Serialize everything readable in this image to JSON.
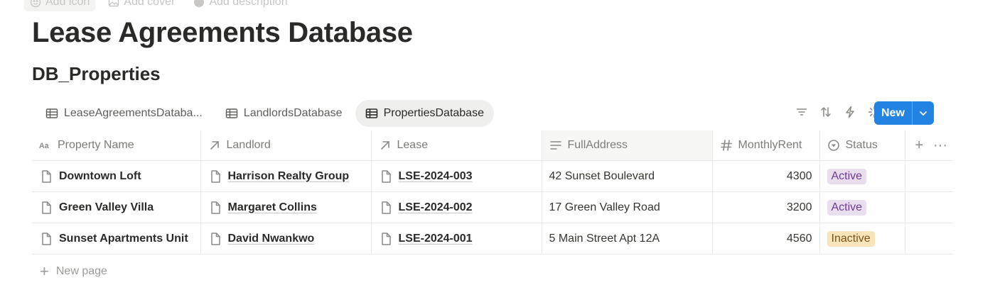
{
  "top_actions": {
    "add_icon": "Add icon",
    "add_cover": "Add cover",
    "add_description": "Add description"
  },
  "page": {
    "title": "Lease Agreements Database",
    "database_title": "DB_Properties"
  },
  "views": [
    {
      "label": "LeaseAgreementsDataba...",
      "icon": "table-icon",
      "active": false
    },
    {
      "label": "LandlordsDatabase",
      "icon": "table-icon",
      "active": false
    },
    {
      "label": "PropertiesDatabase",
      "icon": "table-icon",
      "active": true
    }
  ],
  "toolbar": {
    "icons": [
      "filter-icon",
      "sort-icon",
      "automation-icon",
      "ai-sparkle-icon",
      "search-icon",
      "settings-icon"
    ],
    "new_label": "New",
    "accent": "#2383e2"
  },
  "table": {
    "columns": [
      {
        "label": "Property Name",
        "icon": "text-property-icon"
      },
      {
        "label": "Landlord",
        "icon": "relation-arrow-icon"
      },
      {
        "label": "Lease",
        "icon": "relation-arrow-icon"
      },
      {
        "label": "FullAddress",
        "icon": "long-text-icon"
      },
      {
        "label": "MonthlyRent",
        "icon": "number-hash-icon"
      },
      {
        "label": "Status",
        "icon": "status-icon"
      }
    ],
    "add_column": "+",
    "more": "···",
    "rows": [
      {
        "name": "Downtown Loft",
        "landlord": "Harrison Realty Group",
        "lease": "LSE-2024-003",
        "address": "42 Sunset Boulevard",
        "rent": "4300",
        "status": "Active"
      },
      {
        "name": "Green Valley Villa",
        "landlord": "Margaret Collins",
        "lease": "LSE-2024-002",
        "address": "17 Green Valley Road",
        "rent": "3200",
        "status": "Active"
      },
      {
        "name": "Sunset Apartments Unit",
        "landlord": "David Nwankwo",
        "lease": "LSE-2024-001",
        "address": "5 Main Street Apt 12A",
        "rent": "4560",
        "status": "Inactive"
      }
    ]
  },
  "status_colors": {
    "Active": {
      "bg": "#e8deee",
      "fg": "#6f3b8f"
    },
    "Inactive": {
      "bg": "#f9e4bc",
      "fg": "#7a5419"
    }
  },
  "new_page": {
    "plus": "+",
    "label": "New page"
  }
}
